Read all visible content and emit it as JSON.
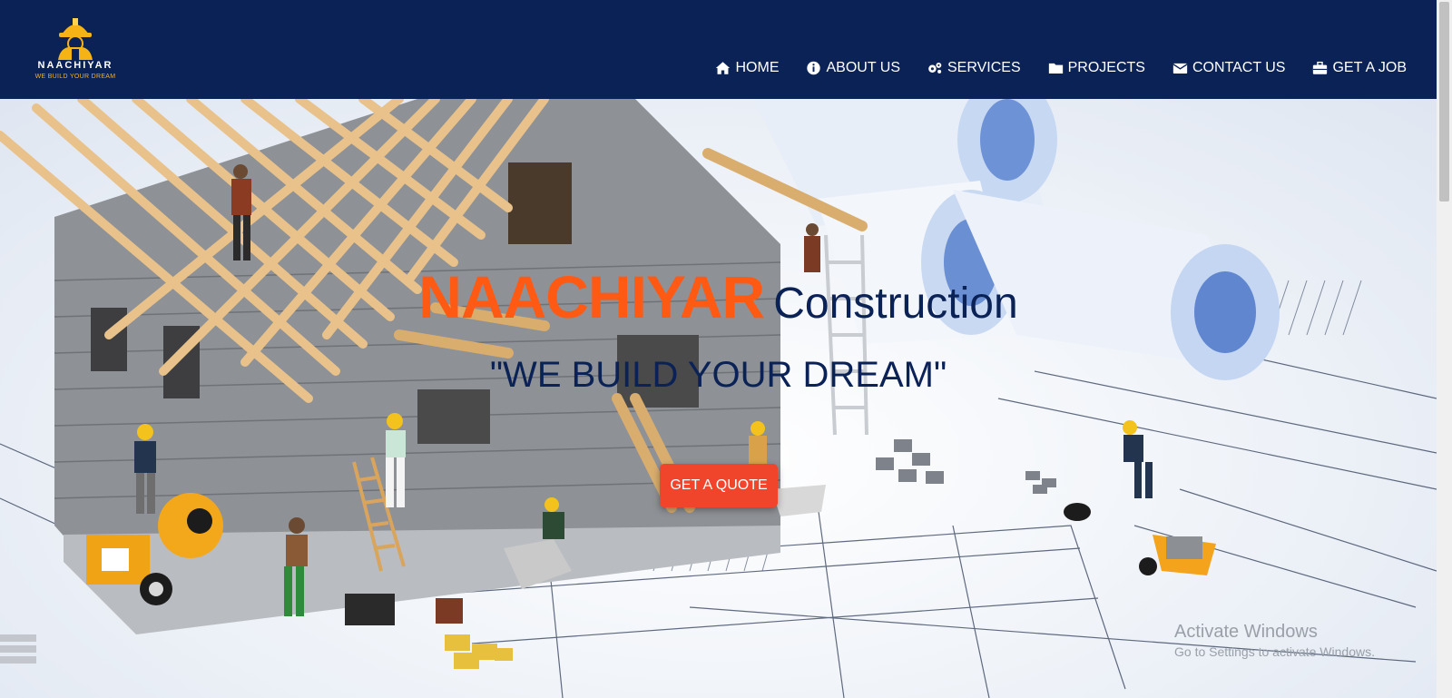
{
  "brand": {
    "logo_word": "NAACHIYAR",
    "logo_tagline": "WE BUILD YOUR DREAM",
    "logo_icon": "helmet-worker-icon"
  },
  "nav": {
    "items": [
      {
        "label": "HOME",
        "icon": "home-icon"
      },
      {
        "label": "ABOUT US",
        "icon": "info-circle-icon"
      },
      {
        "label": "SERVICES",
        "icon": "gears-icon"
      },
      {
        "label": "PROJECTS",
        "icon": "folder-icon"
      },
      {
        "label": "CONTACT US",
        "icon": "envelope-icon"
      },
      {
        "label": "GET A JOB",
        "icon": "briefcase-icon"
      }
    ]
  },
  "hero": {
    "title_brand": "NAACHIYAR",
    "title_rest": "Construction",
    "subtitle": "\"WE BUILD YOUR DREAM\"",
    "cta_label": "GET A QUOTE"
  },
  "watermark": {
    "title": "Activate Windows",
    "subtitle": "Go to Settings to activate Windows."
  },
  "colors": {
    "header_bg": "#0b2257",
    "brand_orange": "#ff5a14",
    "cta_red": "#f1452b",
    "navy_text": "#0b2257"
  }
}
